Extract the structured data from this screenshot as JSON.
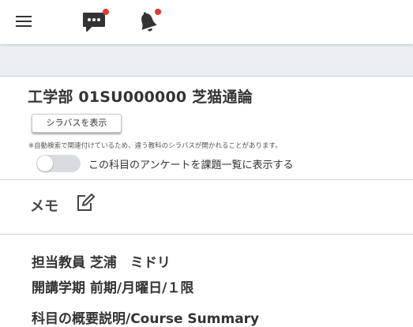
{
  "header": {
    "menu_icon": "hamburger-icon",
    "chat_icon": "chat-bubble-icon",
    "bell_icon": "bell-icon",
    "notification_color": "#e53935"
  },
  "course": {
    "title": "工学部 01SU000000 芝猫通論",
    "syllabus_button": "シラバスを表示",
    "note": "※自動検索で関連付けているため、違う教科のシラバスが開かれることがあります。",
    "survey_toggle_label": "この科目のアンケートを課題一覧に表示する",
    "survey_toggle_on": false
  },
  "memo": {
    "title": "メモ",
    "edit_icon": "pencil-square-icon"
  },
  "details": {
    "instructor": "担当教員 芝浦　ミドリ",
    "schedule": "開講学期 前期/月曜日/１限",
    "summary_heading": "科目の概要説明/Course Summary"
  }
}
